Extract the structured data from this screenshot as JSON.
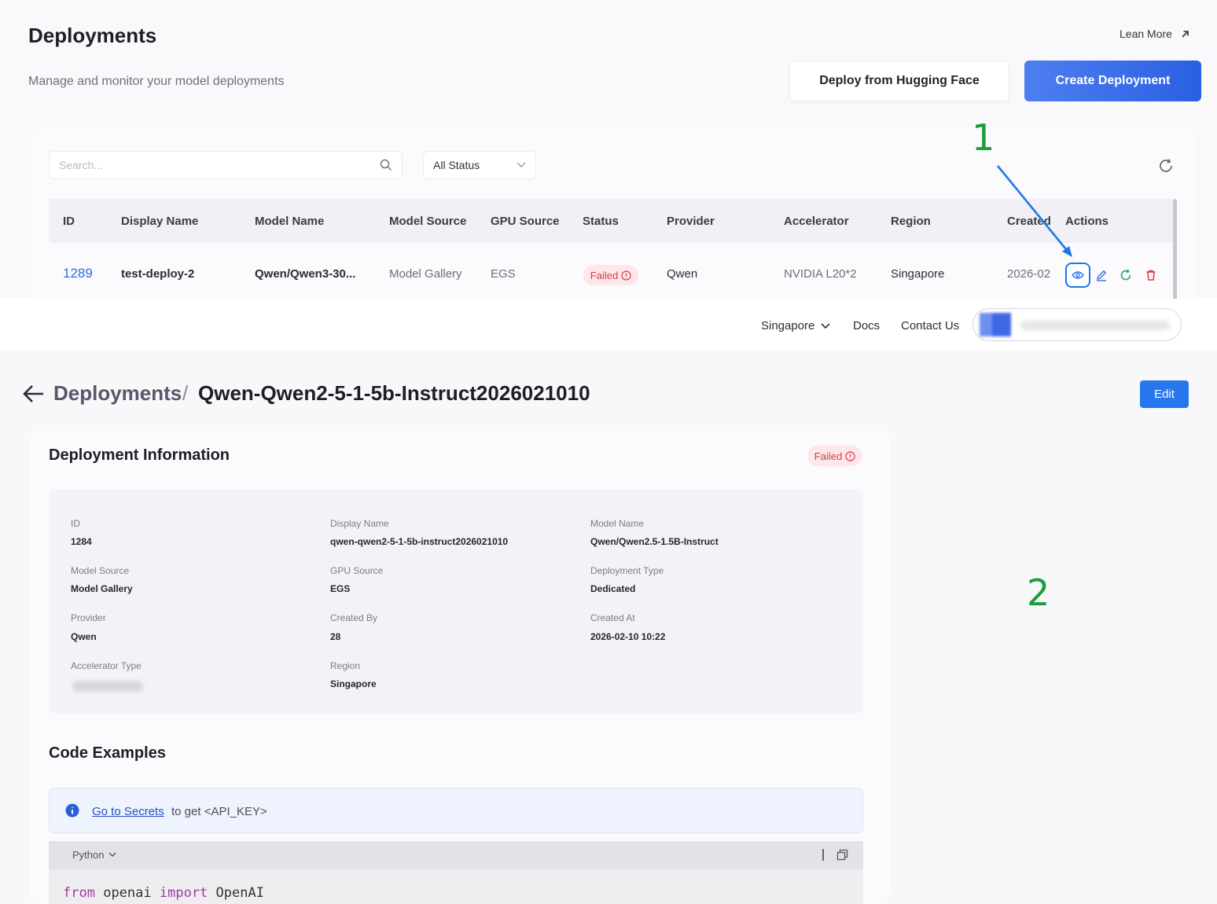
{
  "list": {
    "title": "Deployments",
    "subtitle": "Manage and monitor your model deployments",
    "learn_more": "Lean More",
    "deploy_hf_label": "Deploy from Hugging Face",
    "create_label": "Create Deployment",
    "search_placeholder": "Search...",
    "status_filter": "All Status",
    "columns": [
      "ID",
      "Display Name",
      "Model Name",
      "Model Source",
      "GPU Source",
      "Status",
      "Provider",
      "Accelerator",
      "Region",
      "Created",
      "Actions"
    ],
    "row": {
      "id": "1289",
      "display_name": "test-deploy-2",
      "model_name": "Qwen/Qwen3-30...",
      "model_source": "Model Gallery",
      "gpu_source": "EGS",
      "status": "Failed",
      "provider": "Qwen",
      "accelerator": "NVIDIA L20*2",
      "region": "Singapore",
      "created": "2026-02"
    }
  },
  "footer_nav": {
    "region": "Singapore",
    "docs": "Docs",
    "contact": "Contact Us"
  },
  "annotations": {
    "one": "1",
    "two": "2"
  },
  "detail": {
    "breadcrumb_parent": "Deployments",
    "breadcrumb_sep": "/",
    "breadcrumb_current": "Qwen-Qwen2-5-1-5b-Instruct2026021010",
    "edit_label": "Edit",
    "info_title": "Deployment Information",
    "status": "Failed",
    "fields": {
      "id": {
        "label": "ID",
        "value": "1284"
      },
      "display_name": {
        "label": "Display Name",
        "value": "qwen-qwen2-5-1-5b-instruct2026021010"
      },
      "model_name": {
        "label": "Model Name",
        "value": "Qwen/Qwen2.5-1.5B-Instruct"
      },
      "model_source": {
        "label": "Model Source",
        "value": "Model Gallery"
      },
      "gpu_source": {
        "label": "GPU Source",
        "value": "EGS"
      },
      "deployment_type": {
        "label": "Deployment Type",
        "value": "Dedicated"
      },
      "provider": {
        "label": "Provider",
        "value": "Qwen"
      },
      "created_by": {
        "label": "Created By",
        "value": "28"
      },
      "created_at": {
        "label": "Created At",
        "value": "2026-02-10 10:22"
      },
      "accelerator_type": {
        "label": "Accelerator Type"
      },
      "region": {
        "label": "Region",
        "value": "Singapore"
      }
    },
    "code_title": "Code Examples",
    "notice_link": "Go to Secrets",
    "notice_text": "to get <API_KEY>",
    "language": "Python",
    "code": {
      "kw_from": "from",
      "module": "openai",
      "kw_import": "import",
      "name": "OpenAI"
    }
  },
  "colors": {
    "primary": "#2677ee",
    "failed_bg": "#fde7ea",
    "failed_text": "#d83a4a",
    "annotation_green": "#1a9d3a",
    "annotation_blue": "#1d78e6"
  }
}
